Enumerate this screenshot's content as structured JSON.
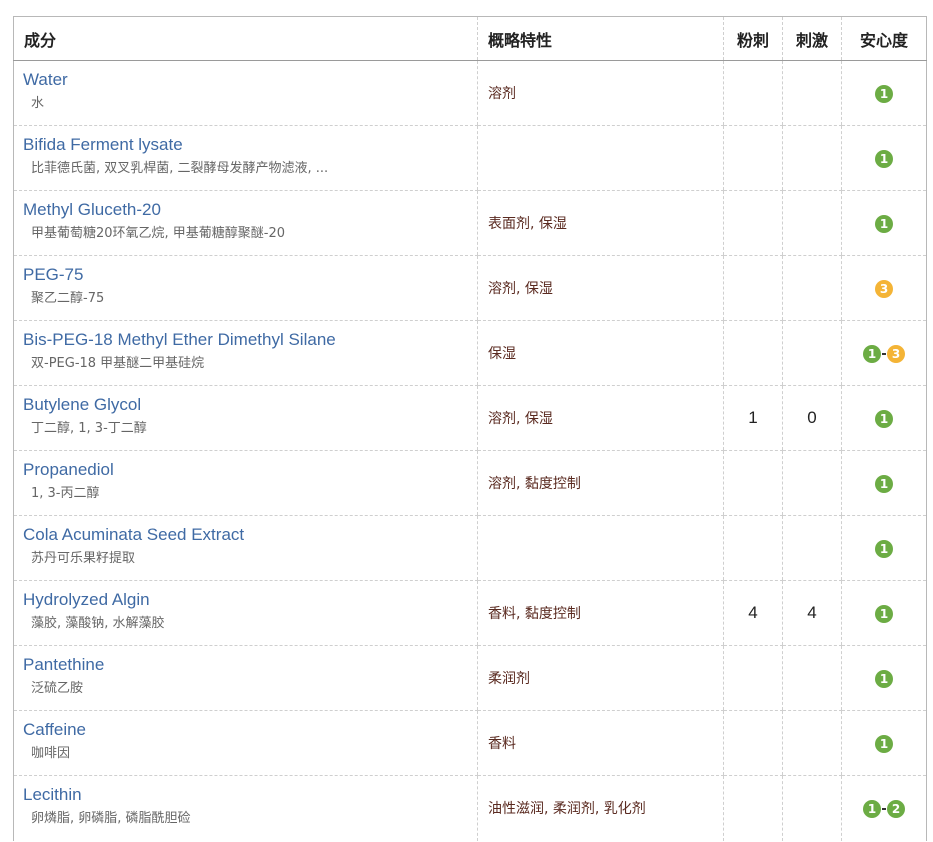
{
  "colors": {
    "link": "#3f6aa4",
    "property_text": "#5a2a20",
    "safety_low": "#6cac44",
    "safety_mid": "#f4b436"
  },
  "headers": {
    "name": "成分",
    "properties": "概略特性",
    "acne": "粉刺",
    "irritation": "刺激",
    "safety": "安心度"
  },
  "rows": [
    {
      "name": "Water",
      "cn": "水",
      "props": "溶剂",
      "acne": "",
      "irr": "",
      "safety_a": "1",
      "safety_a_color": "green",
      "safety_b": "",
      "safety_b_color": ""
    },
    {
      "name": "Bifida Ferment lysate",
      "cn": "比菲德氏菌, 双叉乳桿菌, 二裂酵母发酵产物滤液, ...",
      "props": "",
      "acne": "",
      "irr": "",
      "safety_a": "1",
      "safety_a_color": "green",
      "safety_b": "",
      "safety_b_color": ""
    },
    {
      "name": "Methyl Gluceth-20",
      "cn": "甲基葡萄糖20环氧乙烷, 甲基葡糖醇聚醚-20",
      "props": "表面剂, 保湿",
      "acne": "",
      "irr": "",
      "safety_a": "1",
      "safety_a_color": "green",
      "safety_b": "",
      "safety_b_color": ""
    },
    {
      "name": "PEG-75",
      "cn": "聚乙二醇-75",
      "props": "溶剂, 保湿",
      "acne": "",
      "irr": "",
      "safety_a": "3",
      "safety_a_color": "orange",
      "safety_b": "",
      "safety_b_color": ""
    },
    {
      "name": "Bis-PEG-18 Methyl Ether Dimethyl Silane",
      "cn": "双-PEG-18 甲基醚二甲基硅烷",
      "props": "保湿",
      "acne": "",
      "irr": "",
      "safety_a": "1",
      "safety_a_color": "green",
      "safety_b": "3",
      "safety_b_color": "orange"
    },
    {
      "name": "Butylene Glycol",
      "cn": "丁二醇, 1, 3-丁二醇",
      "props": "溶剂, 保湿",
      "acne": "1",
      "irr": "0",
      "safety_a": "1",
      "safety_a_color": "green",
      "safety_b": "",
      "safety_b_color": ""
    },
    {
      "name": "Propanediol",
      "cn": "1, 3-丙二醇",
      "props": "溶剂, 黏度控制",
      "acne": "",
      "irr": "",
      "safety_a": "1",
      "safety_a_color": "green",
      "safety_b": "",
      "safety_b_color": ""
    },
    {
      "name": "Cola Acuminata Seed Extract",
      "cn": "苏丹可乐果籽提取",
      "props": "",
      "acne": "",
      "irr": "",
      "safety_a": "1",
      "safety_a_color": "green",
      "safety_b": "",
      "safety_b_color": ""
    },
    {
      "name": "Hydrolyzed Algin",
      "cn": "藻胶, 藻酸钠, 水解藻胶",
      "props": "香料, 黏度控制",
      "acne": "4",
      "irr": "4",
      "safety_a": "1",
      "safety_a_color": "green",
      "safety_b": "",
      "safety_b_color": ""
    },
    {
      "name": "Pantethine",
      "cn": "泛硫乙胺",
      "props": "柔润剂",
      "acne": "",
      "irr": "",
      "safety_a": "1",
      "safety_a_color": "green",
      "safety_b": "",
      "safety_b_color": ""
    },
    {
      "name": "Caffeine",
      "cn": "咖啡因",
      "props": "香料",
      "acne": "",
      "irr": "",
      "safety_a": "1",
      "safety_a_color": "green",
      "safety_b": "",
      "safety_b_color": ""
    },
    {
      "name": "Lecithin",
      "cn": "卵燐脂, 卵磷脂, 磷脂酰胆硷",
      "props": "油性滋润, 柔润剂, 乳化剂",
      "acne": "",
      "irr": "",
      "safety_a": "1",
      "safety_a_color": "green",
      "safety_b": "2",
      "safety_b_color": "green"
    }
  ]
}
